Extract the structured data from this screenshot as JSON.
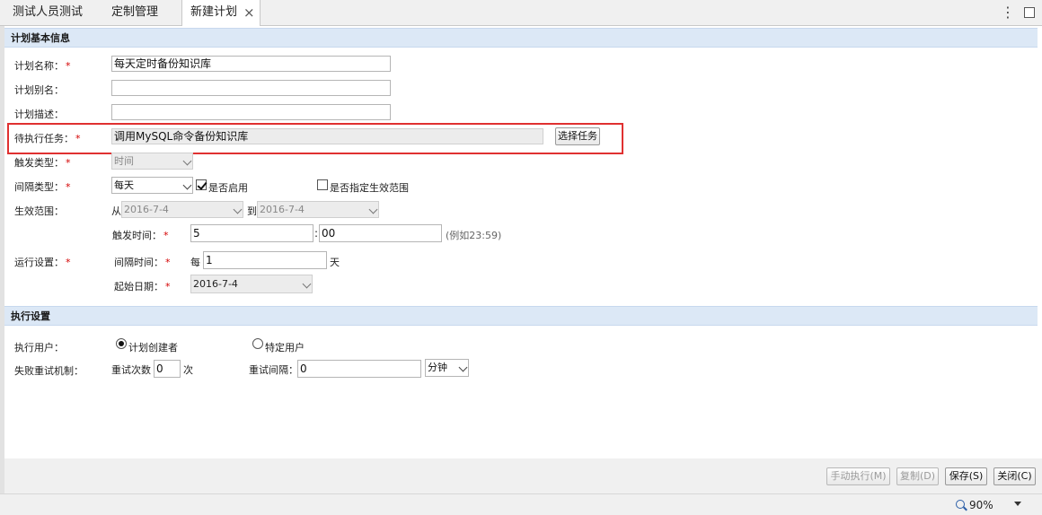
{
  "tabs": [
    {
      "label": "测试人员测试"
    },
    {
      "label": "定制管理"
    },
    {
      "label": "新建计划",
      "close": "×"
    }
  ],
  "more_icon": "⋮",
  "section_basic": "计划基本信息",
  "fields": {
    "plan_name_label": "计划名称：",
    "plan_name_value": "每天定时备份知识库",
    "plan_alias_label": "计划别名：",
    "plan_alias_value": "",
    "plan_desc_label": "计划描述：",
    "plan_desc_value": "",
    "task_label": "待执行任务：",
    "task_value": "调用MySQL命令备份知识库",
    "select_task_button": "选择任务",
    "trigger_type_label": "触发类型：",
    "trigger_type_value": "时间",
    "interval_type_label": "间隔类型：",
    "interval_type_value": "每天",
    "enabled_label": "是否启用",
    "enabled_checked": true,
    "range_specified_label": "是否指定生效范围",
    "range_specified_checked": false,
    "effective_range_label": "生效范围：",
    "from_label": "从",
    "from_value": "2016-7-4",
    "to_label": "到",
    "to_value": "2016-7-4",
    "trigger_time_label": "触发时间：",
    "trigger_hour": "5",
    "colon": ":",
    "trigger_minute": "00",
    "trigger_time_hint": "(例如23:59)",
    "run_settings_label": "运行设置：",
    "interval_time_label": "间隔时间：",
    "every_label": "每",
    "interval_value": "1",
    "day_unit": "天",
    "start_date_label": "起始日期：",
    "start_date_value": "2016-7-4",
    "required_mark": "*"
  },
  "section_exec": "执行设置",
  "exec": {
    "user_label": "执行用户：",
    "creator_option": "计划创建者",
    "creator_selected": true,
    "specific_user_option": "特定用户",
    "retry_label": "失败重试机制：",
    "retry_count_label": "重试次数",
    "retry_count_value": "0",
    "retry_count_unit": "次",
    "retry_interval_label": "重试间隔：",
    "retry_interval_value": "0",
    "retry_interval_unit": "分钟"
  },
  "buttons": {
    "manual_run": "手动执行(M)",
    "copy": "复制(D)",
    "save": "保存(S)",
    "close": "关闭(C)"
  },
  "status": {
    "zoom": "90%"
  },
  "colors": {
    "section_bg": "#dce8f6",
    "highlight_border": "#e03030",
    "required": "#d40000"
  }
}
